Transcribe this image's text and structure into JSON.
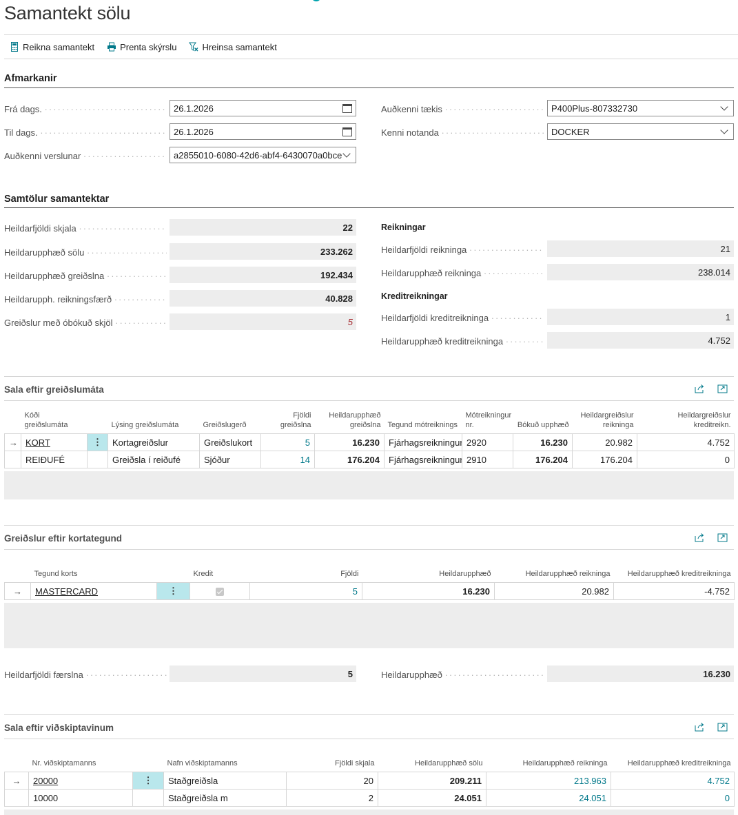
{
  "page": {
    "title": "Samantekt sölu"
  },
  "actions": [
    {
      "label": "Reikna samantekt",
      "icon": "calculator-icon"
    },
    {
      "label": "Prenta skýrslu",
      "icon": "printer-icon"
    },
    {
      "label": "Hreinsa samantekt",
      "icon": "clear-filter-icon"
    }
  ],
  "filters": {
    "heading": "Afmarkanir",
    "from_date": {
      "label": "Frá dags.",
      "value": "26.1.2026"
    },
    "to_date": {
      "label": "Til dags.",
      "value": "26.1.2026"
    },
    "store_id": {
      "label": "Auðkenni verslunar",
      "value": "a2855010-6080-42d6-abf4-6430070a0bce"
    },
    "device_id": {
      "label": "Auðkenni tækis",
      "value": "P400Plus-807332730"
    },
    "user_id": {
      "label": "Kenni notanda",
      "value": "DOCKER"
    }
  },
  "totals": {
    "heading": "Samtölur samantektar",
    "left": [
      {
        "label": "Heildarfjöldi skjala",
        "value": "22"
      },
      {
        "label": "Heildarupphæð sölu",
        "value": "233.262"
      },
      {
        "label": "Heildarupphæð greiðslna",
        "value": "192.434"
      },
      {
        "label": "Heildarupph. reikningsfærð",
        "value": "40.828"
      },
      {
        "label": "Greiðslur með óbókuð skjöl",
        "value": "5"
      }
    ],
    "invoices_heading": "Reikningar",
    "invoices": [
      {
        "label": "Heildarfjöldi reikninga",
        "value": "21"
      },
      {
        "label": "Heildarupphæð reikninga",
        "value": "238.014"
      }
    ],
    "credit_heading": "Kreditreikningar",
    "credit": [
      {
        "label": "Heildarfjöldi kreditreikninga",
        "value": "1"
      },
      {
        "label": "Heildarupphæð kreditreikninga",
        "value": "4.752"
      }
    ]
  },
  "by_payment": {
    "title": "Sala eftir greiðslumáta",
    "columns": [
      "Kóði greiðslumáta",
      "Lýsing greiðslumáta",
      "Greiðslugerð",
      "Fjöldi greiðslna",
      "Heildarupphæð greiðslna",
      "Tegund mótreiknings",
      "Mótreikningur nr.",
      "Bókuð upphæð",
      "Heildargreiðslur reikninga",
      "Heildargreiðslur kreditreikn."
    ],
    "rows": [
      [
        "KORT",
        "Kortagreiðslur",
        "Greiðslukort",
        "5",
        "16.230",
        "Fjárhagsreikningur",
        "2920",
        "16.230",
        "20.982",
        "4.752"
      ],
      [
        "REIÐUFÉ",
        "Greiðsla í reiðufé",
        "Sjóður",
        "14",
        "176.204",
        "Fjárhagsreikningur",
        "2910",
        "176.204",
        "176.204",
        "0"
      ]
    ]
  },
  "by_card": {
    "title": "Greiðslur eftir kortategund",
    "columns": [
      "Tegund korts",
      "Kredit",
      "Fjöldi",
      "Heildarupphæð",
      "Heildarupphæð reikninga",
      "Heildarupphæð kreditreikninga"
    ],
    "rows": [
      [
        "MASTERCARD",
        "",
        "5",
        "16.230",
        "20.982",
        "-4.752"
      ]
    ],
    "total_count": {
      "label": "Heildarfjöldi færslna",
      "value": "5"
    },
    "total_amount": {
      "label": "Heildarupphæð",
      "value": "16.230"
    }
  },
  "by_customer": {
    "title": "Sala eftir viðskiptavinum",
    "columns": [
      "Nr. viðskiptamanns",
      "Nafn viðskiptamanns",
      "Fjöldi skjala",
      "Heildarupphæð sölu",
      "Heildarupphæð reikninga",
      "Heildarupphæð kreditreikninga"
    ],
    "rows": [
      [
        "20000",
        "Staðgreiðsla",
        "20",
        "209.211",
        "213.963",
        "4.752"
      ],
      [
        "10000",
        "Staðgreiðsla m",
        "2",
        "24.051",
        "24.051",
        "0"
      ]
    ]
  }
}
